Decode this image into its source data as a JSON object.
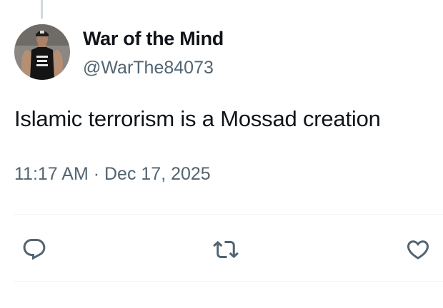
{
  "tweet": {
    "author": {
      "display_name": "War of the Mind",
      "handle": "@WarThe84073"
    },
    "text": "Islamic terrorism is a Mossad creation",
    "timestamp": "11:17 AM · Dec 17, 2025"
  },
  "actions": {
    "reply_icon": "speech-bubble",
    "retweet_icon": "repost-arrows",
    "like_icon": "heart-outline"
  },
  "colors": {
    "primary_text": "#0f1419",
    "secondary_text": "#536471",
    "divider": "#eff3f4",
    "thread_line": "#cfd9de"
  }
}
